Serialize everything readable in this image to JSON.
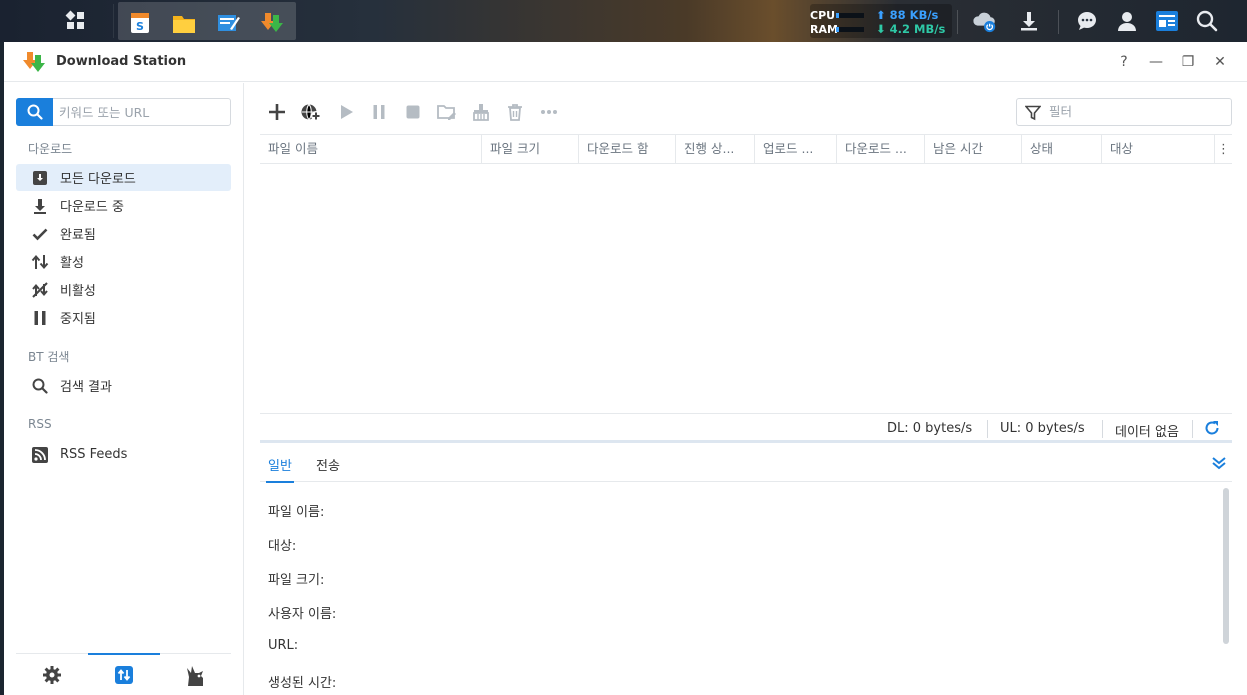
{
  "taskbar": {
    "cpu_label": "CPU",
    "ram_label": "RAM",
    "upload_rate": "88 KB/s",
    "download_rate": "4.2 MB/s",
    "upload_color": "#3aa0ff",
    "download_color": "#2ec8a6"
  },
  "window": {
    "title": "Download Station",
    "help": "?",
    "minimize": "—",
    "maximize": "❐",
    "close": "✕"
  },
  "sidebar": {
    "search_placeholder": "키워드 또는 URL",
    "section_downloads": "다운로드",
    "items": [
      {
        "label": "모든 다운로드",
        "icon": "all-downloads-icon",
        "active": true
      },
      {
        "label": "다운로드 중",
        "icon": "downloading-icon"
      },
      {
        "label": "완료됨",
        "icon": "check-icon"
      },
      {
        "label": "활성",
        "icon": "active-arrows-icon"
      },
      {
        "label": "비활성",
        "icon": "inactive-icon"
      },
      {
        "label": "중지됨",
        "icon": "pause-icon"
      }
    ],
    "section_bt": "BT 검색",
    "bt_item": "검색 결과",
    "section_rss": "RSS",
    "rss_item": "RSS Feeds"
  },
  "toolbar": {
    "filter_placeholder": "필터"
  },
  "table": {
    "columns": [
      "파일 이름",
      "파일 크기",
      "다운로드 함",
      "진행 상...",
      "업로드 ...",
      "다운로드 ...",
      "남은 시간",
      "상태",
      "대상"
    ]
  },
  "status": {
    "dl": "DL: 0 bytes/s",
    "ul": "UL: 0 bytes/s",
    "no_data": "데이터 없음"
  },
  "detail_tabs": [
    "일반",
    "전송"
  ],
  "detail_fields": [
    "파일 이름:",
    "대상:",
    "파일 크기:",
    "사용자 이름:",
    "URL:",
    "생성된 시간:"
  ],
  "accent_color": "#1a7fdc"
}
